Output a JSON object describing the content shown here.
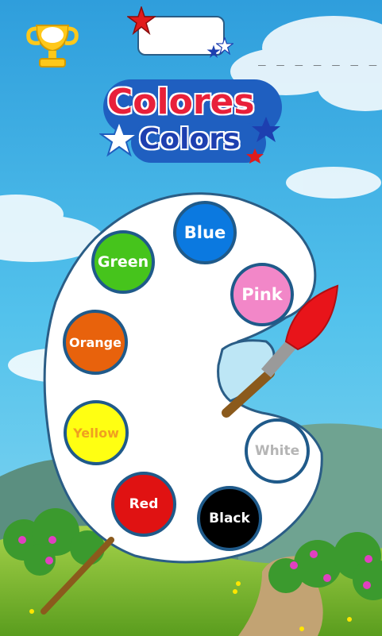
{
  "header": {
    "answer_blanks": "_ _ _ _ _ _ _"
  },
  "logo": {
    "title_es": "Colores",
    "title_en": "Colors"
  },
  "palette": {
    "colors": [
      {
        "label": "Blue",
        "fill": "#0b79e0",
        "text": "#ffffff"
      },
      {
        "label": "Green",
        "fill": "#46c41c",
        "text": "#ffffff"
      },
      {
        "label": "Pink",
        "fill": "#f287c8",
        "text": "#ffffff"
      },
      {
        "label": "Orange",
        "fill": "#e8620c",
        "text": "#ffffff"
      },
      {
        "label": "Yellow",
        "fill": "#ffff12",
        "text": "#f0a020"
      },
      {
        "label": "White",
        "fill": "#ffffff",
        "text": "#b5b5b5"
      },
      {
        "label": "Red",
        "fill": "#e01212",
        "text": "#ffffff"
      },
      {
        "label": "Black",
        "fill": "#000000",
        "text": "#ffffff"
      }
    ]
  }
}
